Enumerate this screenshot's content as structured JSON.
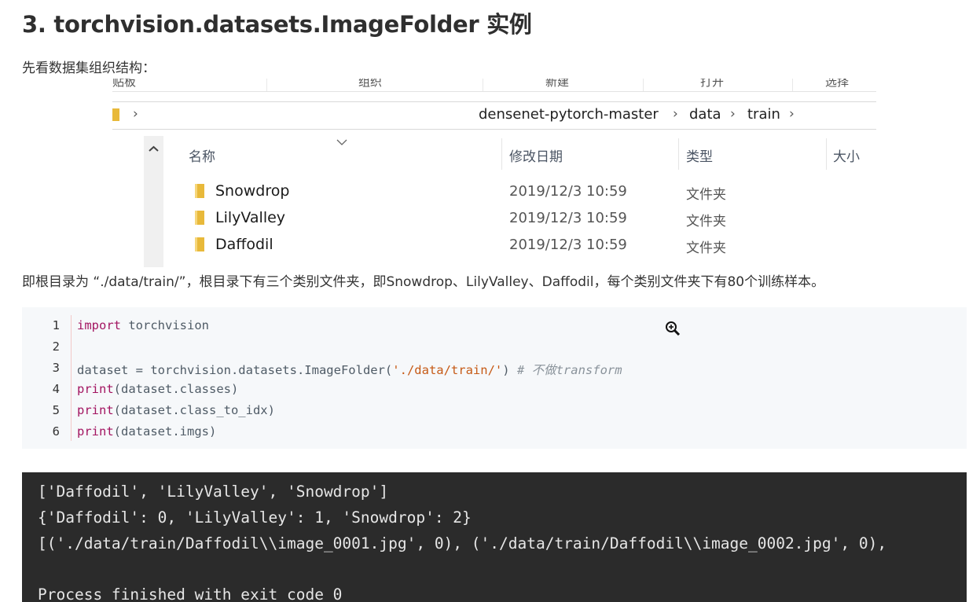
{
  "article": {
    "title": "3. torchvision.datasets.ImageFolder 实例",
    "intro": "先看数据集组织结构：",
    "description": "即根目录为 “./data/train/”，根目录下有三个类别文件夹，即Snowdrop、LilyValley、Daffodil，每个类别文件夹下有80个训练样本。"
  },
  "explorer": {
    "ribbon": [
      "贴板",
      "组织",
      "新建",
      "打开",
      "选择"
    ],
    "breadcrumb": [
      "densenet-pytorch-master",
      "data",
      "train"
    ],
    "columns": {
      "name": "名称",
      "date": "修改日期",
      "type": "类型",
      "size": "大小"
    },
    "rows": [
      {
        "name": "Snowdrop",
        "date": "2019/12/3 10:59",
        "type": "文件夹"
      },
      {
        "name": "LilyValley",
        "date": "2019/12/3 10:59",
        "type": "文件夹"
      },
      {
        "name": "Daffodil",
        "date": "2019/12/3 10:59",
        "type": "文件夹"
      }
    ]
  },
  "code": {
    "line_numbers": [
      "1",
      "2",
      "3",
      "4",
      "5",
      "6"
    ],
    "lines": [
      {
        "kw": "import",
        "text": " torchvision"
      },
      {
        "text": ""
      },
      {
        "pre": "dataset = torchvision.datasets.ImageFolder(",
        "str": "'./data/train/'",
        "post": ") ",
        "comment": "# 不做transform"
      },
      {
        "kw": "print",
        "text": "(dataset.classes)"
      },
      {
        "kw": "print",
        "text": "(dataset.class_to_idx)"
      },
      {
        "kw": "print",
        "text": "(dataset.imgs)"
      }
    ]
  },
  "terminal": {
    "lines": [
      "['Daffodil', 'LilyValley', 'Snowdrop']",
      "{'Daffodil': 0, 'LilyValley': 1, 'Snowdrop': 2}",
      "[('./data/train/Daffodil\\\\image_0001.jpg', 0), ('./data/train/Daffodil\\\\image_0002.jpg', 0),",
      "",
      "Process finished with exit code 0"
    ]
  },
  "colors": {
    "code_bg": "#f6f8fa",
    "keyword": "#a31561",
    "string": "#c65a16",
    "comment": "#8a939b",
    "terminal_bg": "#2b2b2b",
    "folder": "#e8b93a"
  }
}
